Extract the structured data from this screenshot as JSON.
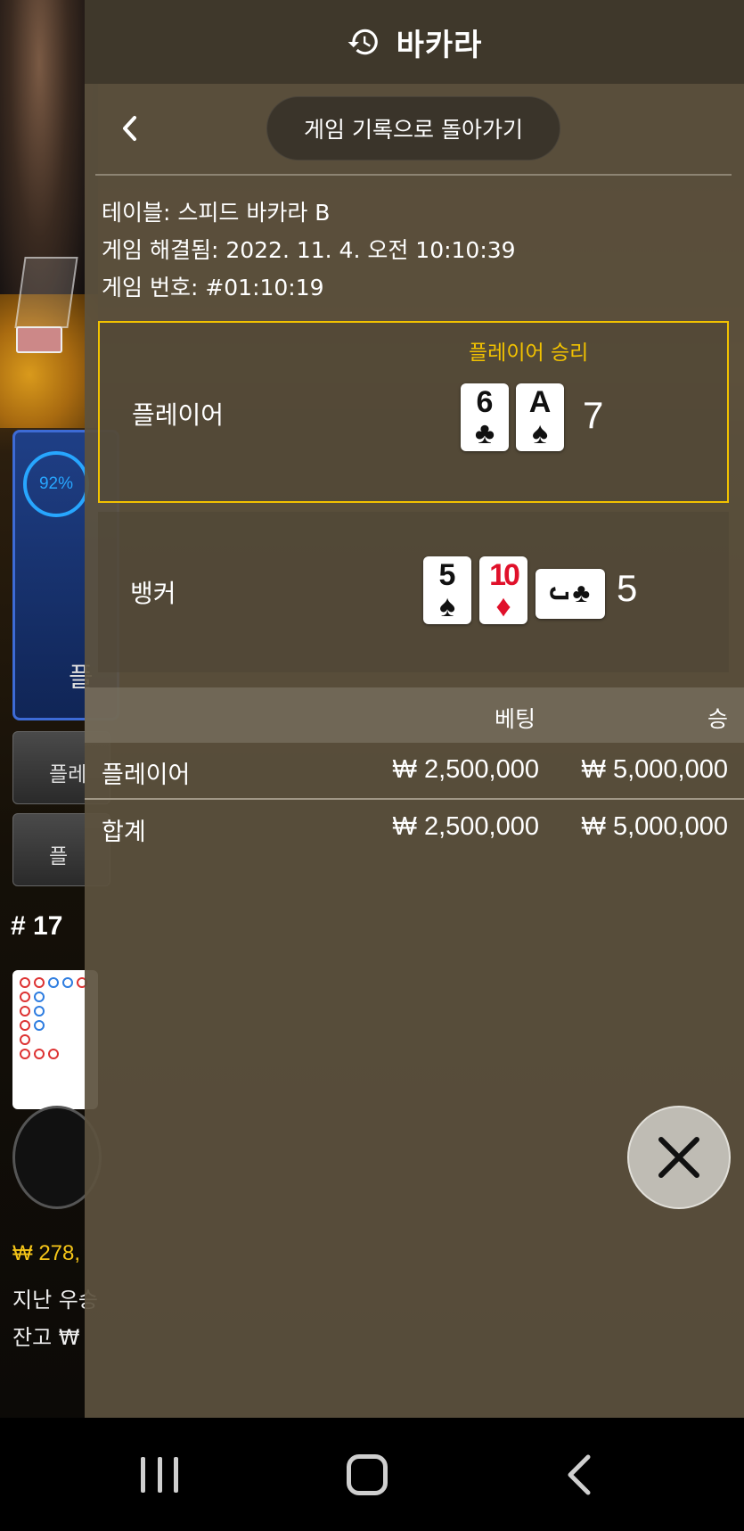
{
  "background": {
    "timer_percent": "92%",
    "bet_button_1": "플레",
    "bet_button_2": "플",
    "bet_label_partial": "플",
    "round_number": "# 17",
    "balance_partial": "₩ 278,",
    "last_win_label": "지난 우승",
    "wallet_label": "잔고 ₩"
  },
  "panel": {
    "title": "바카라",
    "back_button_label": "게임 기록으로 돌아가기",
    "info": {
      "table": "테이블: 스피드 바카라 B",
      "resolved": "게임 해결됨: 2022. 11. 4. 오전 10:10:39",
      "game_number": "게임 번호: #01:10:19"
    },
    "player": {
      "label": "플레이어",
      "win_label": "플레이어 승리",
      "score": "7",
      "cards": [
        {
          "rank": "6",
          "suit": "♣",
          "color": "black"
        },
        {
          "rank": "A",
          "suit": "♠",
          "color": "black"
        }
      ]
    },
    "banker": {
      "label": "뱅커",
      "score": "5",
      "cards": [
        {
          "rank": "5",
          "suit": "♠",
          "color": "black"
        },
        {
          "rank": "10",
          "suit": "♦",
          "color": "red"
        },
        {
          "rank": "J",
          "suit": "♣",
          "color": "black",
          "rotated": true
        }
      ]
    },
    "bets": {
      "headers": {
        "bet": "베팅",
        "win": "승"
      },
      "rows": [
        {
          "name": "플레이어",
          "bet": "₩ 2,500,000",
          "win": "₩ 5,000,000"
        },
        {
          "name": "합계",
          "bet": "₩ 2,500,000",
          "win": "₩ 5,000,000"
        }
      ]
    }
  },
  "colors": {
    "accent_gold": "#f2c200",
    "panel_bg": "#5c523e",
    "timer_blue": "#27a6ff"
  },
  "icons": {
    "header": "history-icon",
    "back": "chevron-left-icon",
    "close": "close-icon",
    "nav": [
      "recents-icon",
      "home-icon",
      "back-icon"
    ]
  }
}
